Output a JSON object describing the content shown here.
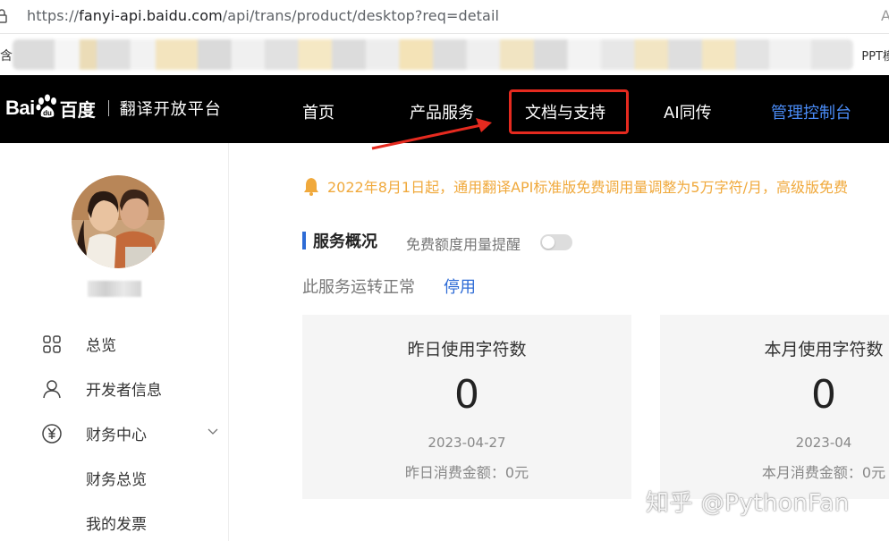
{
  "browser": {
    "url_prefix": "https://",
    "url_host": "fanyi-api.baidu.com",
    "url_path": "/api/trans/product/desktop?req=detail",
    "right_fragment": "A",
    "bookmark_left": "含",
    "bookmark_right": "PPT模"
  },
  "navbar": {
    "logo_bai": "Bai",
    "logo_cn": "百度",
    "logo_sub": "翻译开放平台",
    "items": [
      "首页",
      "产品服务",
      "文档与支持",
      "AI同传",
      "管理控制台"
    ]
  },
  "sidebar": {
    "items": [
      {
        "label": "总览",
        "icon": "grid-icon"
      },
      {
        "label": "开发者信息",
        "icon": "user-icon"
      },
      {
        "label": "财务中心",
        "icon": "yen-icon"
      }
    ],
    "subitems": [
      "财务总览",
      "我的发票"
    ]
  },
  "main": {
    "notice": "2022年8月1日起，通用翻译API标准版免费调用量调整为5万字符/月，高级版免费",
    "section_title": "服务概况",
    "quota_label": "免费额度用量提醒",
    "status_text": "此服务运转正常",
    "stop_link": "停用",
    "cards": [
      {
        "title": "昨日使用字符数",
        "value": "0",
        "date": "2023-04-27",
        "amount": "昨日消费金额：0元"
      },
      {
        "title": "本月使用字符数",
        "value": "0",
        "date": "2023-04",
        "amount": "本月消费金额：0元"
      }
    ]
  },
  "watermark": "知乎 @PythonFan",
  "colors": {
    "nav_bg": "#000000",
    "console_link": "#4a8cf7",
    "notice": "#f0a93c",
    "accent_blue": "#2d6bd6",
    "highlight_red": "#e52a1f"
  }
}
